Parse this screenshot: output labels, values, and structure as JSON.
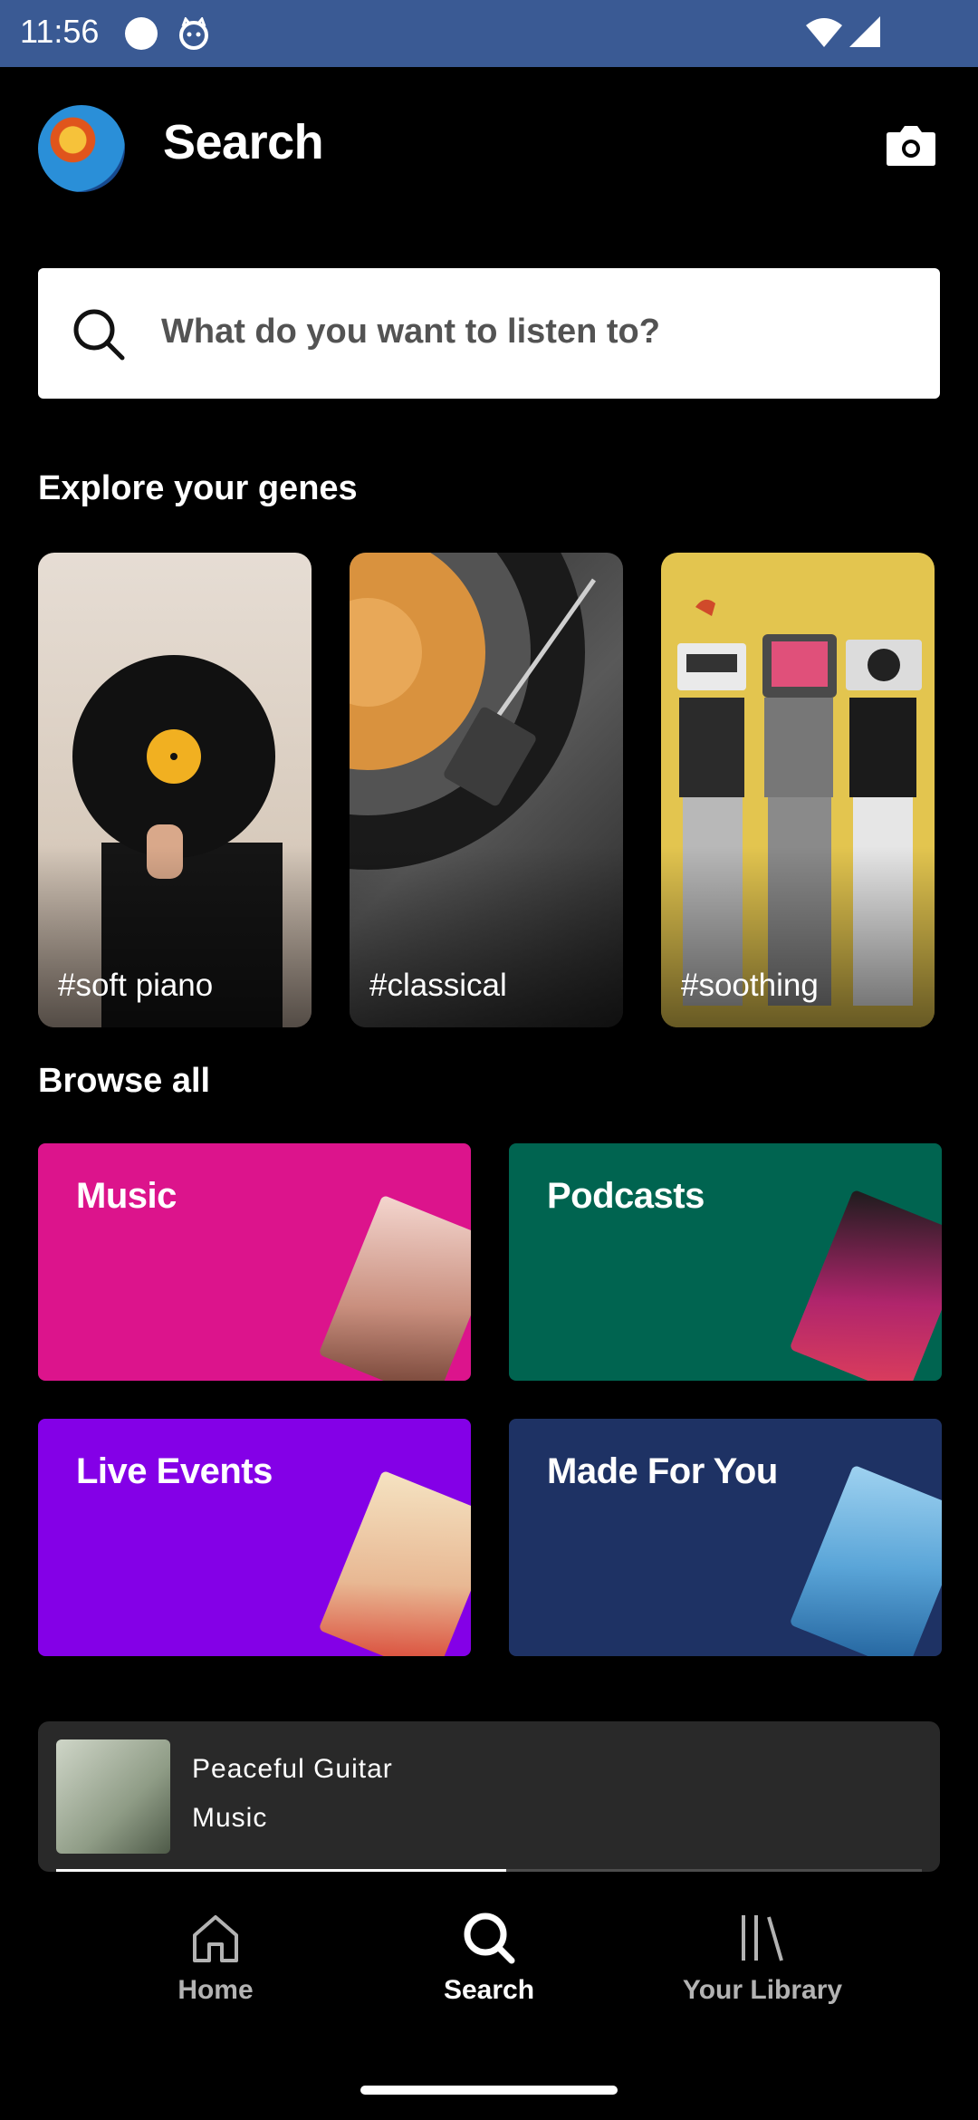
{
  "status_bar": {
    "time": "11:56"
  },
  "header": {
    "title": "Search"
  },
  "search": {
    "placeholder": "What do you want to listen to?"
  },
  "explore": {
    "title": "Explore your genes",
    "cards": [
      {
        "label": "#soft piano"
      },
      {
        "label": "#classical"
      },
      {
        "label": "#soothing"
      }
    ]
  },
  "browse": {
    "title": "Browse all",
    "tiles": [
      {
        "label": "Music",
        "color": "#dc148c"
      },
      {
        "label": "Podcasts",
        "color": "#006450"
      },
      {
        "label": "Live Events",
        "color": "#8400e7"
      },
      {
        "label": "Made For You",
        "color": "#1e3264"
      }
    ]
  },
  "player": {
    "title": "Peaceful Guitar",
    "subtitle": "Music",
    "progress": 0.52
  },
  "nav": {
    "items": [
      {
        "label": "Home",
        "icon": "home-icon"
      },
      {
        "label": "Search",
        "icon": "search-icon",
        "active": true
      },
      {
        "label": "Your Library",
        "icon": "library-icon"
      }
    ]
  },
  "colors": {
    "accent_green": "#1db954",
    "background": "#000000",
    "status_bar": "#3a5a94"
  }
}
